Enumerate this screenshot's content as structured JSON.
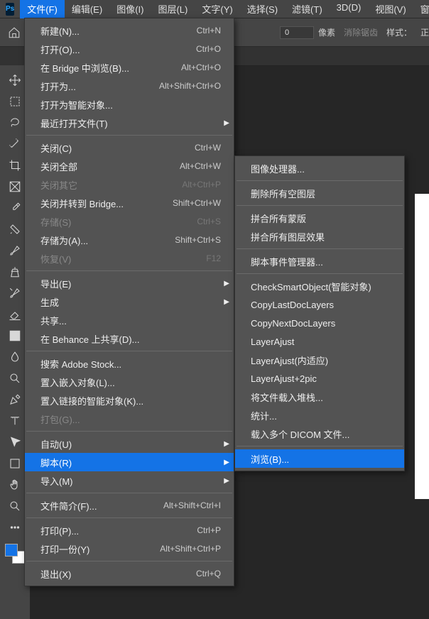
{
  "app_icon": "Ps",
  "menubar": [
    "文件(F)",
    "编辑(E)",
    "图像(I)",
    "图层(L)",
    "文字(Y)",
    "选择(S)",
    "滤镜(T)",
    "3D(D)",
    "视图(V)",
    "窗"
  ],
  "menubar_active": 0,
  "options": {
    "px_value": "0",
    "px_unit": "像素",
    "anti_alias": "消除锯齿",
    "style": "样式：",
    "norm": "正"
  },
  "file_menu": [
    {
      "type": "item",
      "label": "新建(N)...",
      "sc": "Ctrl+N"
    },
    {
      "type": "item",
      "label": "打开(O)...",
      "sc": "Ctrl+O"
    },
    {
      "type": "item",
      "label": "在 Bridge 中浏览(B)...",
      "sc": "Alt+Ctrl+O"
    },
    {
      "type": "item",
      "label": "打开为...",
      "sc": "Alt+Shift+Ctrl+O"
    },
    {
      "type": "item",
      "label": "打开为智能对象..."
    },
    {
      "type": "sub",
      "label": "最近打开文件(T)"
    },
    {
      "type": "sep"
    },
    {
      "type": "item",
      "label": "关闭(C)",
      "sc": "Ctrl+W"
    },
    {
      "type": "item",
      "label": "关闭全部",
      "sc": "Alt+Ctrl+W"
    },
    {
      "type": "item",
      "label": "关闭其它",
      "sc": "Alt+Ctrl+P",
      "disabled": true
    },
    {
      "type": "item",
      "label": "关闭并转到 Bridge...",
      "sc": "Shift+Ctrl+W"
    },
    {
      "type": "item",
      "label": "存储(S)",
      "sc": "Ctrl+S",
      "disabled": true
    },
    {
      "type": "item",
      "label": "存储为(A)...",
      "sc": "Shift+Ctrl+S"
    },
    {
      "type": "item",
      "label": "恢复(V)",
      "sc": "F12",
      "disabled": true
    },
    {
      "type": "sep"
    },
    {
      "type": "sub",
      "label": "导出(E)"
    },
    {
      "type": "sub",
      "label": "生成"
    },
    {
      "type": "item",
      "label": "共享..."
    },
    {
      "type": "item",
      "label": "在 Behance 上共享(D)..."
    },
    {
      "type": "sep"
    },
    {
      "type": "item",
      "label": "搜索 Adobe Stock..."
    },
    {
      "type": "item",
      "label": "置入嵌入对象(L)..."
    },
    {
      "type": "item",
      "label": "置入链接的智能对象(K)..."
    },
    {
      "type": "item",
      "label": "打包(G)...",
      "disabled": true
    },
    {
      "type": "sep"
    },
    {
      "type": "sub",
      "label": "自动(U)"
    },
    {
      "type": "sub",
      "label": "脚本(R)",
      "hover": true
    },
    {
      "type": "sub",
      "label": "导入(M)"
    },
    {
      "type": "sep"
    },
    {
      "type": "item",
      "label": "文件简介(F)...",
      "sc": "Alt+Shift+Ctrl+I"
    },
    {
      "type": "sep"
    },
    {
      "type": "item",
      "label": "打印(P)...",
      "sc": "Ctrl+P"
    },
    {
      "type": "item",
      "label": "打印一份(Y)",
      "sc": "Alt+Shift+Ctrl+P"
    },
    {
      "type": "sep"
    },
    {
      "type": "item",
      "label": "退出(X)",
      "sc": "Ctrl+Q"
    }
  ],
  "scripts_menu": [
    {
      "type": "item",
      "label": "图像处理器..."
    },
    {
      "type": "sep"
    },
    {
      "type": "item",
      "label": "删除所有空图层"
    },
    {
      "type": "sep"
    },
    {
      "type": "item",
      "label": "拼合所有蒙版"
    },
    {
      "type": "item",
      "label": "拼合所有图层效果"
    },
    {
      "type": "sep"
    },
    {
      "type": "item",
      "label": "脚本事件管理器..."
    },
    {
      "type": "sep"
    },
    {
      "type": "item",
      "label": "CheckSmartObject(智能对象)"
    },
    {
      "type": "item",
      "label": "CopyLastDocLayers"
    },
    {
      "type": "item",
      "label": "CopyNextDocLayers"
    },
    {
      "type": "item",
      "label": "LayerAjust"
    },
    {
      "type": "item",
      "label": "LayerAjust(内适应)"
    },
    {
      "type": "item",
      "label": "LayerAjust+2pic"
    },
    {
      "type": "item",
      "label": "将文件载入堆栈..."
    },
    {
      "type": "item",
      "label": "统计..."
    },
    {
      "type": "item",
      "label": "载入多个 DICOM 文件..."
    },
    {
      "type": "sep"
    },
    {
      "type": "item",
      "label": "浏览(B)...",
      "hover": true
    }
  ],
  "tools": [
    "move",
    "marquee",
    "lasso",
    "wand",
    "crop",
    "frame",
    "eyedropper",
    "healing",
    "brush",
    "clone",
    "history-brush",
    "eraser",
    "gradient",
    "blur",
    "dodge",
    "pen",
    "type",
    "path-select",
    "rectangle",
    "hand",
    "zoom",
    "edit-toolbar"
  ]
}
